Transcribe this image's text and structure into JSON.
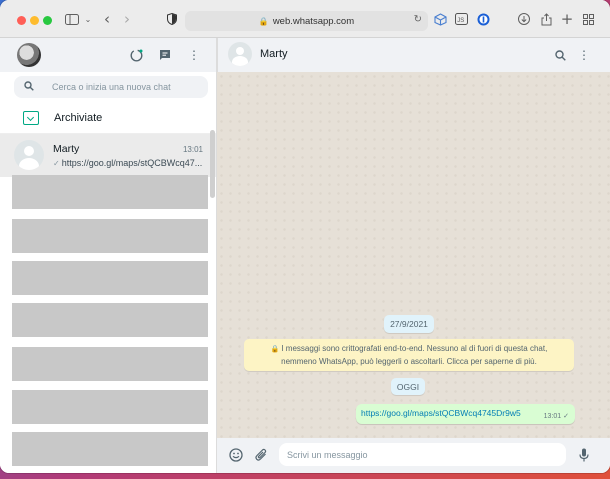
{
  "browser": {
    "url": "web.whatsapp.com",
    "traffic_light_colors": [
      "#ff5f57",
      "#febc2e",
      "#28c840"
    ]
  },
  "sidebar": {
    "search": {
      "placeholder": "Cerca o inizia una nuova chat",
      "value": ""
    },
    "archived_label": "Archiviate",
    "chats": [
      {
        "name": "Marty",
        "time": "13:01",
        "last_message": "https://goo.gl/maps/stQCBWcq47..."
      }
    ],
    "accent_color": "#00a884"
  },
  "conversation": {
    "contact_name": "Marty",
    "date_chip": "27/9/2021",
    "encryption_notice_line1": "I messaggi sono crittografati end-to-end. Nessuno al di fuori di questa chat,",
    "encryption_notice_line2": "nemmeno WhatsApp, può leggerli o ascoltarli. Clicca per saperne di più.",
    "today_chip": "OGGI",
    "messages": [
      {
        "text": "https://goo.gl/maps/stQCBWcq4745Dr9w5",
        "time": "13:01",
        "status": "✓"
      }
    ],
    "composer": {
      "placeholder": "Scrivi un messaggio",
      "value": ""
    }
  }
}
